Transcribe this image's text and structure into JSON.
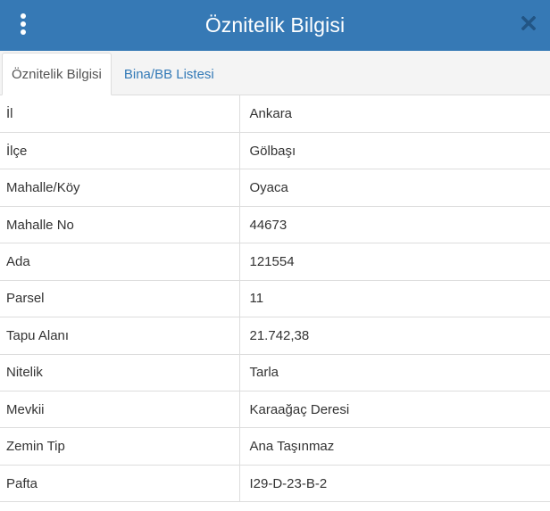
{
  "header": {
    "title": "Öznitelik Bilgisi",
    "menu_icon": "vertical-dots-icon",
    "close_icon": "close-icon",
    "bg_color": "#3679b5"
  },
  "tabs": [
    {
      "label": "Öznitelik Bilgisi",
      "active": true
    },
    {
      "label": "Bina/BB Listesi",
      "active": false
    }
  ],
  "attributes": [
    {
      "key": "İl",
      "value": "Ankara"
    },
    {
      "key": "İlçe",
      "value": "Gölbaşı"
    },
    {
      "key": "Mahalle/Köy",
      "value": "Oyaca"
    },
    {
      "key": "Mahalle No",
      "value": "44673"
    },
    {
      "key": "Ada",
      "value": "121554"
    },
    {
      "key": "Parsel",
      "value": "11"
    },
    {
      "key": "Tapu Alanı",
      "value": "21.742,38"
    },
    {
      "key": "Nitelik",
      "value": "Tarla"
    },
    {
      "key": "Mevkii",
      "value": "Karaağaç Deresi"
    },
    {
      "key": "Zemin Tip",
      "value": "Ana Taşınmaz"
    },
    {
      "key": "Pafta",
      "value": "I29-D-23-B-2"
    }
  ]
}
